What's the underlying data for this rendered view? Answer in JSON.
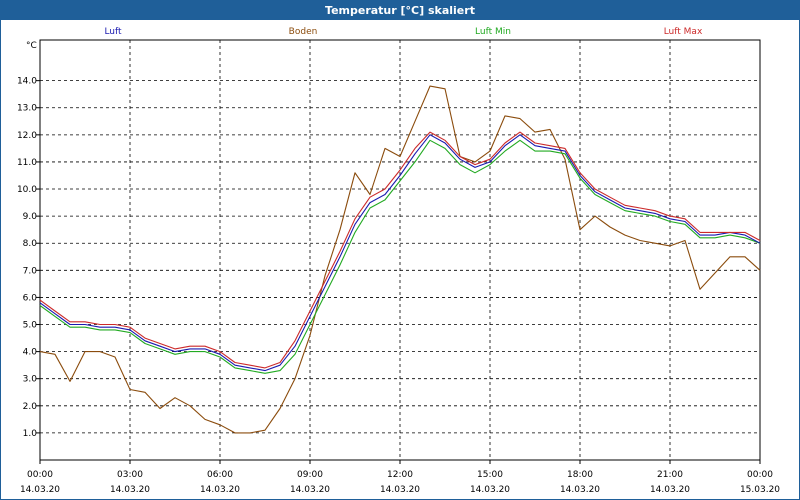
{
  "window": {
    "title": "Temperatur [°C] skaliert"
  },
  "chart_data": {
    "type": "line",
    "title": "Temperatur [°C] skaliert",
    "ylabel": "°C",
    "xlabel": "",
    "ylim": [
      0.0,
      15.5
    ],
    "xlim": [
      0,
      24
    ],
    "grid": true,
    "legend": "top",
    "yticks": [
      1.0,
      2.0,
      3.0,
      4.0,
      5.0,
      6.0,
      7.0,
      8.0,
      9.0,
      10.0,
      11.0,
      12.0,
      13.0,
      14.0
    ],
    "xticks": [
      {
        "x": 0,
        "time": "00:00",
        "date": "14.03.20"
      },
      {
        "x": 3,
        "time": "03:00",
        "date": "14.03.20"
      },
      {
        "x": 6,
        "time": "06:00",
        "date": "14.03.20"
      },
      {
        "x": 9,
        "time": "09:00",
        "date": "14.03.20"
      },
      {
        "x": 12,
        "time": "12:00",
        "date": "14.03.20"
      },
      {
        "x": 15,
        "time": "15:00",
        "date": "14.03.20"
      },
      {
        "x": 18,
        "time": "18:00",
        "date": "14.03.20"
      },
      {
        "x": 21,
        "time": "21:00",
        "date": "14.03.20"
      },
      {
        "x": 24,
        "time": "00:00",
        "date": "15.03.20"
      }
    ],
    "series": [
      {
        "name": "Luft",
        "color": "#1a1ab0",
        "x": [
          0,
          0.5,
          1,
          1.5,
          2,
          2.5,
          3,
          3.5,
          4,
          4.5,
          5,
          5.5,
          6,
          6.5,
          7,
          7.5,
          8,
          8.5,
          9,
          9.5,
          10,
          10.5,
          11,
          11.5,
          12,
          12.5,
          13,
          13.5,
          14,
          14.5,
          15,
          15.5,
          16,
          16.5,
          17,
          17.5,
          18,
          18.5,
          19,
          19.5,
          20,
          20.5,
          21,
          21.5,
          22,
          22.5,
          23,
          23.5,
          24
        ],
        "y": [
          5.8,
          5.4,
          5.0,
          5.0,
          4.9,
          4.9,
          4.8,
          4.4,
          4.2,
          4.0,
          4.1,
          4.1,
          3.9,
          3.5,
          3.4,
          3.3,
          3.5,
          4.2,
          5.3,
          6.4,
          7.5,
          8.7,
          9.5,
          9.8,
          10.5,
          11.3,
          12.0,
          11.7,
          11.1,
          10.8,
          11.0,
          11.6,
          12.0,
          11.6,
          11.5,
          11.4,
          10.5,
          9.9,
          9.6,
          9.3,
          9.2,
          9.1,
          8.9,
          8.8,
          8.3,
          8.3,
          8.4,
          8.3,
          8.0
        ]
      },
      {
        "name": "Boden",
        "color": "#8b4c0d",
        "x": [
          0,
          0.5,
          1,
          1.5,
          2,
          2.5,
          3,
          3.5,
          4,
          4.5,
          5,
          5.5,
          6,
          6.5,
          7,
          7.5,
          8,
          8.5,
          9,
          9.5,
          10,
          10.5,
          11,
          11.5,
          12,
          12.5,
          13,
          13.5,
          14,
          14.5,
          15,
          15.5,
          16,
          16.5,
          17,
          17.5,
          18,
          18.5,
          19,
          19.5,
          20,
          20.5,
          21,
          21.5,
          22,
          22.5,
          23,
          23.5,
          24
        ],
        "y": [
          4.0,
          3.9,
          2.9,
          4.0,
          4.0,
          3.8,
          2.6,
          2.5,
          1.9,
          2.3,
          2.0,
          1.5,
          1.3,
          1.0,
          1.0,
          1.1,
          1.9,
          3.0,
          4.6,
          6.8,
          8.5,
          10.6,
          9.8,
          11.5,
          11.2,
          12.5,
          13.8,
          13.7,
          11.2,
          11.0,
          11.4,
          12.7,
          12.6,
          12.1,
          12.2,
          11.1,
          8.5,
          9.0,
          8.6,
          8.3,
          8.1,
          8.0,
          7.9,
          8.1,
          6.3,
          6.9,
          7.5,
          7.5,
          7.0
        ]
      },
      {
        "name": "Luft Min",
        "color": "#22aa22",
        "x": [
          0,
          0.5,
          1,
          1.5,
          2,
          2.5,
          3,
          3.5,
          4,
          4.5,
          5,
          5.5,
          6,
          6.5,
          7,
          7.5,
          8,
          8.5,
          9,
          9.5,
          10,
          10.5,
          11,
          11.5,
          12,
          12.5,
          13,
          13.5,
          14,
          14.5,
          15,
          15.5,
          16,
          16.5,
          17,
          17.5,
          18,
          18.5,
          19,
          19.5,
          20,
          20.5,
          21,
          21.5,
          22,
          22.5,
          23,
          23.5,
          24
        ],
        "y": [
          5.7,
          5.3,
          4.9,
          4.9,
          4.8,
          4.8,
          4.7,
          4.3,
          4.1,
          3.9,
          4.0,
          4.0,
          3.8,
          3.4,
          3.3,
          3.2,
          3.3,
          3.9,
          5.0,
          6.1,
          7.2,
          8.4,
          9.3,
          9.6,
          10.3,
          11.0,
          11.8,
          11.5,
          10.9,
          10.6,
          10.9,
          11.4,
          11.8,
          11.4,
          11.4,
          11.3,
          10.4,
          9.8,
          9.5,
          9.2,
          9.1,
          9.0,
          8.8,
          8.7,
          8.2,
          8.2,
          8.3,
          8.2,
          8.0
        ]
      },
      {
        "name": "Luft Max",
        "color": "#cc2a2a",
        "x": [
          0,
          0.5,
          1,
          1.5,
          2,
          2.5,
          3,
          3.5,
          4,
          4.5,
          5,
          5.5,
          6,
          6.5,
          7,
          7.5,
          8,
          8.5,
          9,
          9.5,
          10,
          10.5,
          11,
          11.5,
          12,
          12.5,
          13,
          13.5,
          14,
          14.5,
          15,
          15.5,
          16,
          16.5,
          17,
          17.5,
          18,
          18.5,
          19,
          19.5,
          20,
          20.5,
          21,
          21.5,
          22,
          22.5,
          23,
          23.5,
          24
        ],
        "y": [
          5.9,
          5.5,
          5.1,
          5.1,
          5.0,
          5.0,
          4.9,
          4.5,
          4.3,
          4.1,
          4.2,
          4.2,
          4.0,
          3.6,
          3.5,
          3.4,
          3.6,
          4.4,
          5.5,
          6.6,
          7.7,
          8.9,
          9.7,
          10.0,
          10.7,
          11.5,
          12.1,
          11.8,
          11.2,
          10.9,
          11.1,
          11.7,
          12.1,
          11.7,
          11.6,
          11.5,
          10.6,
          10.0,
          9.7,
          9.4,
          9.3,
          9.2,
          9.0,
          8.9,
          8.4,
          8.4,
          8.4,
          8.4,
          8.1
        ]
      }
    ]
  }
}
